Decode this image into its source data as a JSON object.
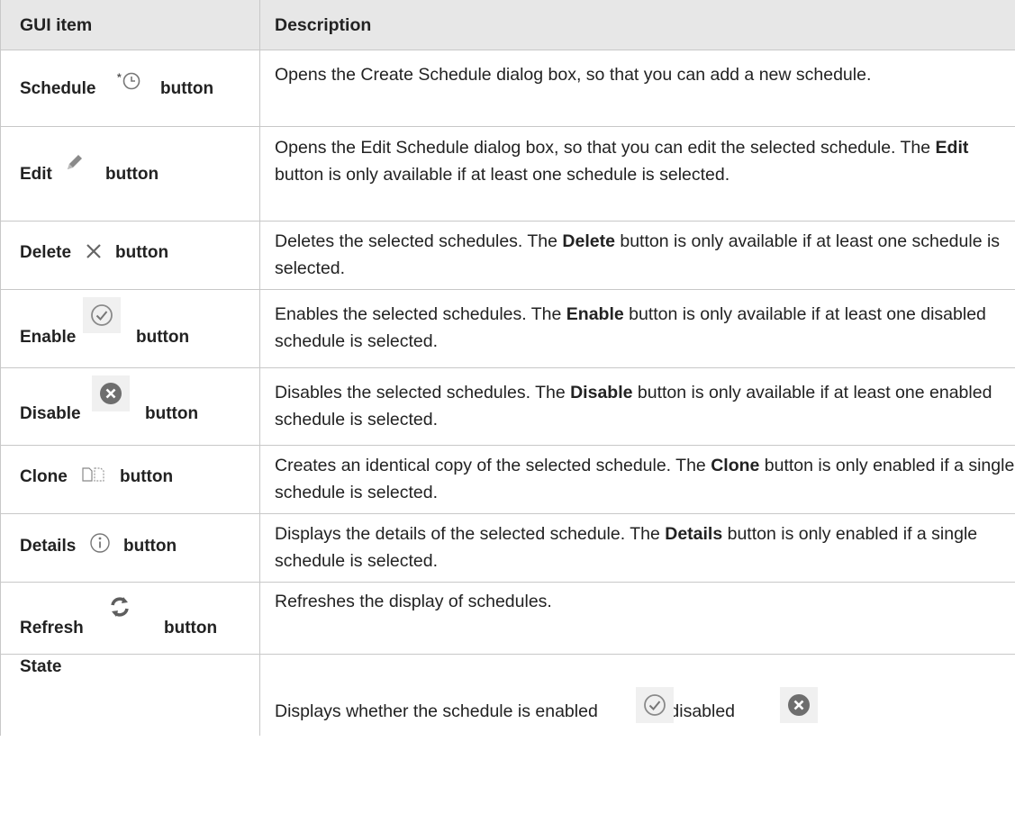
{
  "header": {
    "col1": "GUI item",
    "col2": "Description"
  },
  "rows": [
    {
      "item": "Schedule",
      "suffix": "button",
      "icon": "schedule-icon",
      "desc": "Opens the Create Schedule dialog box, so that you can add a new schedule."
    },
    {
      "item": "Edit",
      "suffix": "button",
      "icon": "pencil-icon",
      "desc_a": "Opens the Edit Schedule dialog box, so that you can edit the selected schedule. The ",
      "desc_bold": "Edit",
      "desc_b": " button is only available if at least one schedule is selected."
    },
    {
      "item": "Delete",
      "suffix": "button",
      "icon": "delete-x-icon",
      "desc_a": "Deletes the selected schedules. The ",
      "desc_bold": "Delete",
      "desc_b": " button is only available if at least one schedule is selected."
    },
    {
      "item": "Enable",
      "suffix": "button",
      "icon": "check-circle-icon",
      "desc_a": "Enables the selected schedules. The ",
      "desc_bold": "Enable",
      "desc_b": " button is only available if at least one disabled schedule is selected."
    },
    {
      "item": "Disable",
      "suffix": "button",
      "icon": "disable-circle-icon",
      "desc_a": "Disables the selected schedules. The ",
      "desc_bold": "Disable",
      "desc_b": " button is only available if at least one enabled schedule is selected."
    },
    {
      "item": "Clone",
      "suffix": "button",
      "icon": "clone-icon",
      "desc_a": "Creates an identical copy of the selected schedule. The ",
      "desc_bold": "Clone",
      "desc_b": " button is only enabled if a single schedule is selected."
    },
    {
      "item": "Details",
      "suffix": "button",
      "icon": "info-icon",
      "desc_a": "Displays the details of the selected schedule. The ",
      "desc_bold": "Details",
      "desc_b": " button is only enabled if a single schedule is selected."
    },
    {
      "item": "Refresh",
      "suffix": "button",
      "icon": "refresh-icon",
      "desc": "Refreshes the display of schedules."
    },
    {
      "item": "State",
      "desc_a": "Displays whether the schedule is enabled ",
      "desc_mid": " or disabled ",
      "desc_end": "."
    }
  ],
  "colors": {
    "header_bg": "#e7e7e7",
    "border": "#c8c8c8",
    "text": "#222222"
  }
}
